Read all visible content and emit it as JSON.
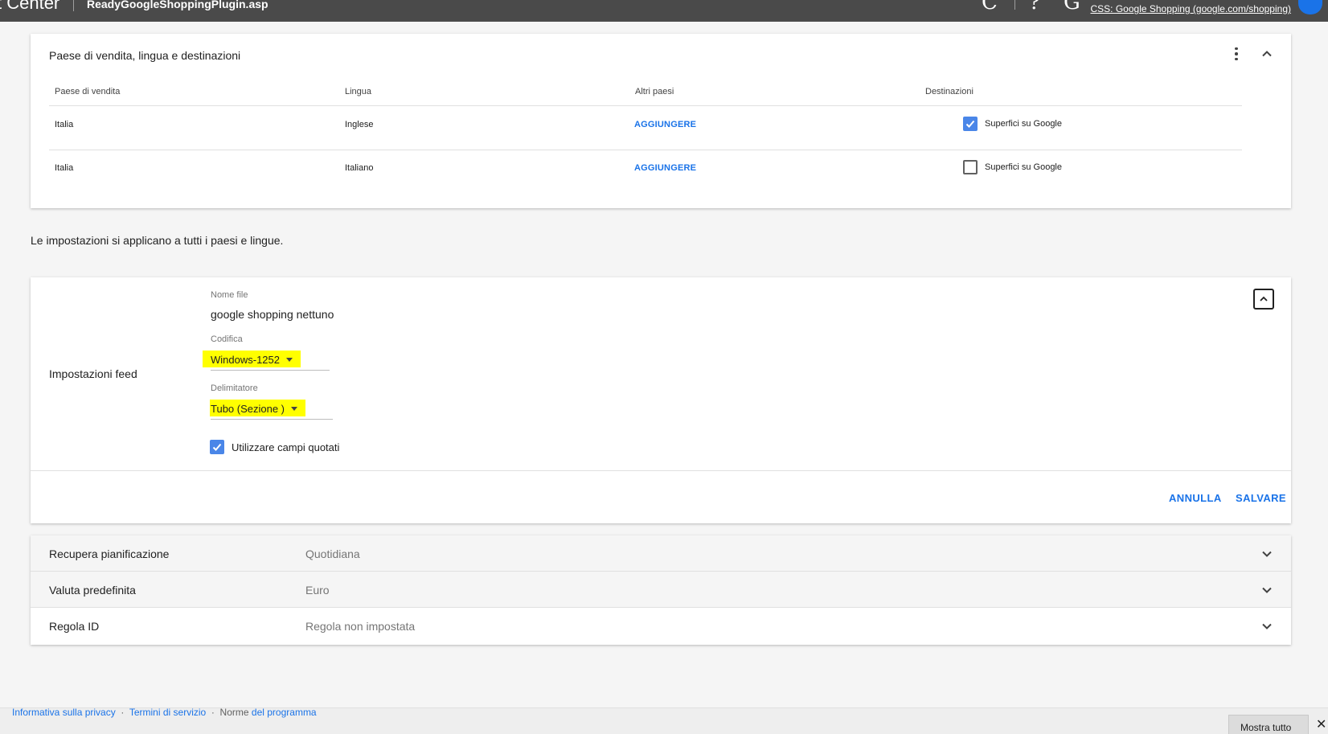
{
  "topbar": {
    "app_title": "t Center",
    "feed_name": "ReadyGoogleShoppingPlugin.asp",
    "icons": [
      "refresh-icon",
      "help-icon",
      "google-icon"
    ],
    "css_label": "CSS: Google Shopping (google.com/shopping)"
  },
  "countries_card": {
    "title": "Paese di vendita, lingua e destinazioni",
    "headers": {
      "country": "Paese di vendita",
      "language": "Lingua",
      "other": "Altri paesi",
      "destinations": "Destinazioni"
    },
    "rows": [
      {
        "country": "Italia",
        "language": "Inglese",
        "add_label": "AGGIUNGERE",
        "destination": "Superfici su Google",
        "checked": true
      },
      {
        "country": "Italia",
        "language": "Italiano",
        "add_label": "AGGIUNGERE",
        "destination": "Superfici su Google",
        "checked": false
      }
    ]
  },
  "info_text": "Le impostazioni si applicano a tutti i paesi e lingue.",
  "feed_settings": {
    "section_label": "Impostazioni feed",
    "file_name_label": "Nome file",
    "file_name_value": "google shopping nettuno",
    "encoding_label": "Codifica",
    "encoding_value": "Windows-1252",
    "delimiter_label": "Delimitatore",
    "delimiter_value": "Tubo (Sezione )",
    "quoted_fields_label": "Utilizzare campi quotati",
    "quoted_fields_checked": true,
    "cancel_label": "ANNULLA",
    "save_label": "SALVARE",
    "highlight_color": "#ffff00"
  },
  "collapsed_rows": [
    {
      "label": "Recupera pianificazione",
      "value": "Quotidiana"
    },
    {
      "label": "Valuta predefinita",
      "value": "Euro"
    },
    {
      "label": "Regola ID",
      "value": "Regola non impostata"
    }
  ],
  "footer": {
    "privacy": "Informativa sulla privacy",
    "terms": "Termini di servizio",
    "program_prefix": "Norme",
    "program_link": "del programma",
    "show_all": "Mostra tutto"
  },
  "colors": {
    "accent": "#1a73e8",
    "checkbox": "#4a86e8",
    "topbar": "#4a4a4a"
  }
}
